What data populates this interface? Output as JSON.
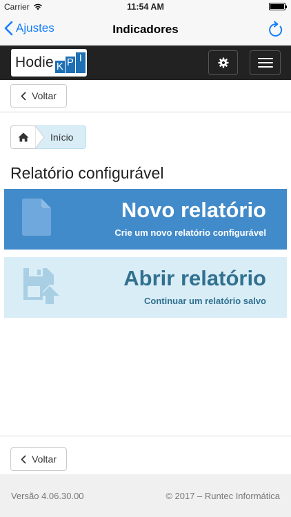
{
  "status_bar": {
    "carrier": "Carrier",
    "time": "11:54 AM",
    "wifi_icon": "wifi-icon",
    "battery_icon": "battery-icon"
  },
  "nav_bar": {
    "back_label": "Ajustes",
    "title": "Indicadores",
    "refresh_icon": "refresh-icon"
  },
  "header": {
    "logo_text": "Hodie",
    "logo_kpi": [
      "K",
      "P",
      "I"
    ],
    "settings_icon": "gear-icon",
    "menu_icon": "hamburger-icon"
  },
  "top_back": {
    "label": "Voltar"
  },
  "breadcrumb": {
    "home_icon": "home-icon",
    "items": [
      {
        "label": "Início"
      }
    ]
  },
  "page": {
    "title": "Relatório configurável"
  },
  "tiles": {
    "new": {
      "title": "Novo relatório",
      "subtitle": "Crie um novo relatório configurável",
      "icon": "file-icon"
    },
    "open": {
      "title": "Abrir relatório",
      "subtitle": "Continuar um relatório salvo",
      "icon": "save-upload-icon"
    }
  },
  "bottom_back": {
    "label": "Voltar"
  },
  "footer": {
    "version": "Versão 4.06.30.00",
    "copyright": "© 2017 – Runtec Informática"
  },
  "colors": {
    "ios_blue": "#157efb",
    "header_bg": "#222222",
    "tile_primary": "#428bca",
    "tile_info": "#d9edf7",
    "tile_info_text": "#31708f"
  }
}
